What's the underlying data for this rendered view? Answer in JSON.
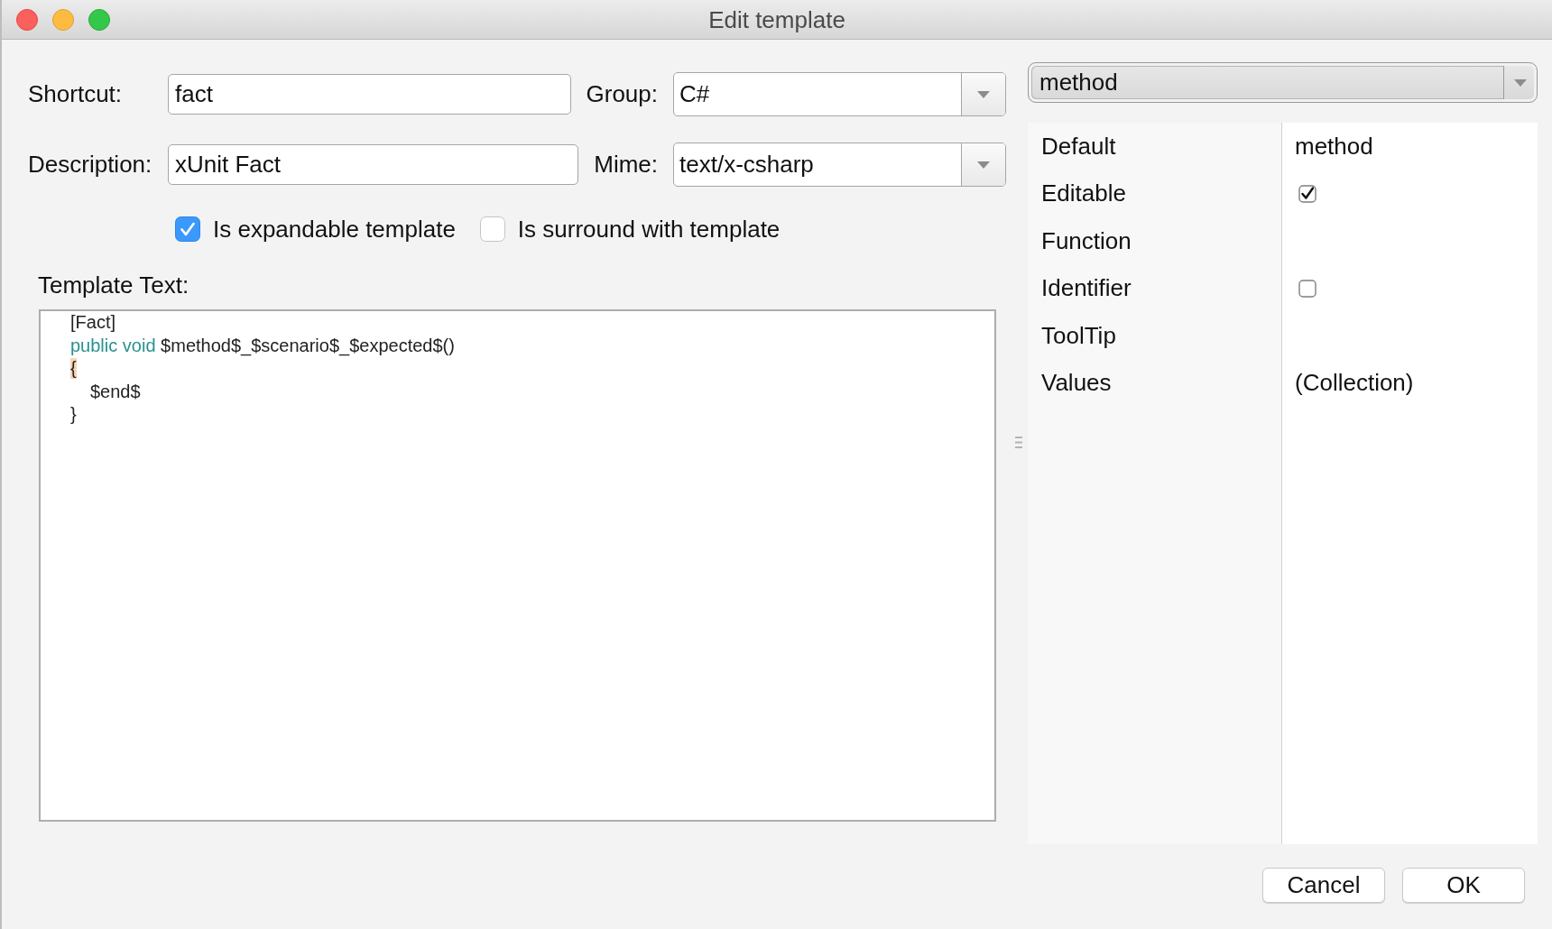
{
  "window": {
    "title": "Edit template"
  },
  "form": {
    "rows": [
      {
        "label": "Shortcut:",
        "value": "fact",
        "select": {
          "label": "Group:",
          "value": "C#"
        }
      },
      {
        "label": "Description:",
        "value": "xUnit Fact",
        "select": {
          "label": "Mime:",
          "value": "text/x-csharp"
        }
      }
    ],
    "options": [
      {
        "label": "Is expandable template",
        "checked": true
      },
      {
        "label": "Is surround with template",
        "checked": false
      }
    ],
    "template_text": {
      "label": "Template Text:",
      "lines": [
        {
          "tokens": [
            {
              "text": "[Fact]",
              "kind": "plain"
            }
          ]
        },
        {
          "tokens": [
            {
              "text": "public void",
              "kind": "keyword"
            },
            {
              "text": "$method$_$scenario$_$expected$()",
              "kind": "plain"
            }
          ]
        },
        {
          "tokens": [
            {
              "text": "{",
              "kind": "brace_match"
            }
          ],
          "children": [
            {
              "tokens": [
                {
                  "text": "$end$",
                  "kind": "plain"
                }
              ]
            }
          ]
        },
        {
          "tokens": [
            {
              "text": "}",
              "kind": "plain"
            }
          ]
        }
      ]
    }
  },
  "variable": {
    "value": "method"
  },
  "properties": [
    {
      "name": "Default",
      "kind": "text",
      "value": "method"
    },
    {
      "name": "Editable",
      "kind": "checkbox",
      "checked": true
    },
    {
      "name": "Function",
      "kind": "text"
    },
    {
      "name": "Identifier",
      "kind": "checkbox",
      "checked": false
    },
    {
      "name": "ToolTip",
      "kind": "text"
    },
    {
      "name": "Values",
      "kind": "text",
      "value": "(Collection)"
    }
  ],
  "buttons": [
    "Cancel",
    "OK"
  ]
}
